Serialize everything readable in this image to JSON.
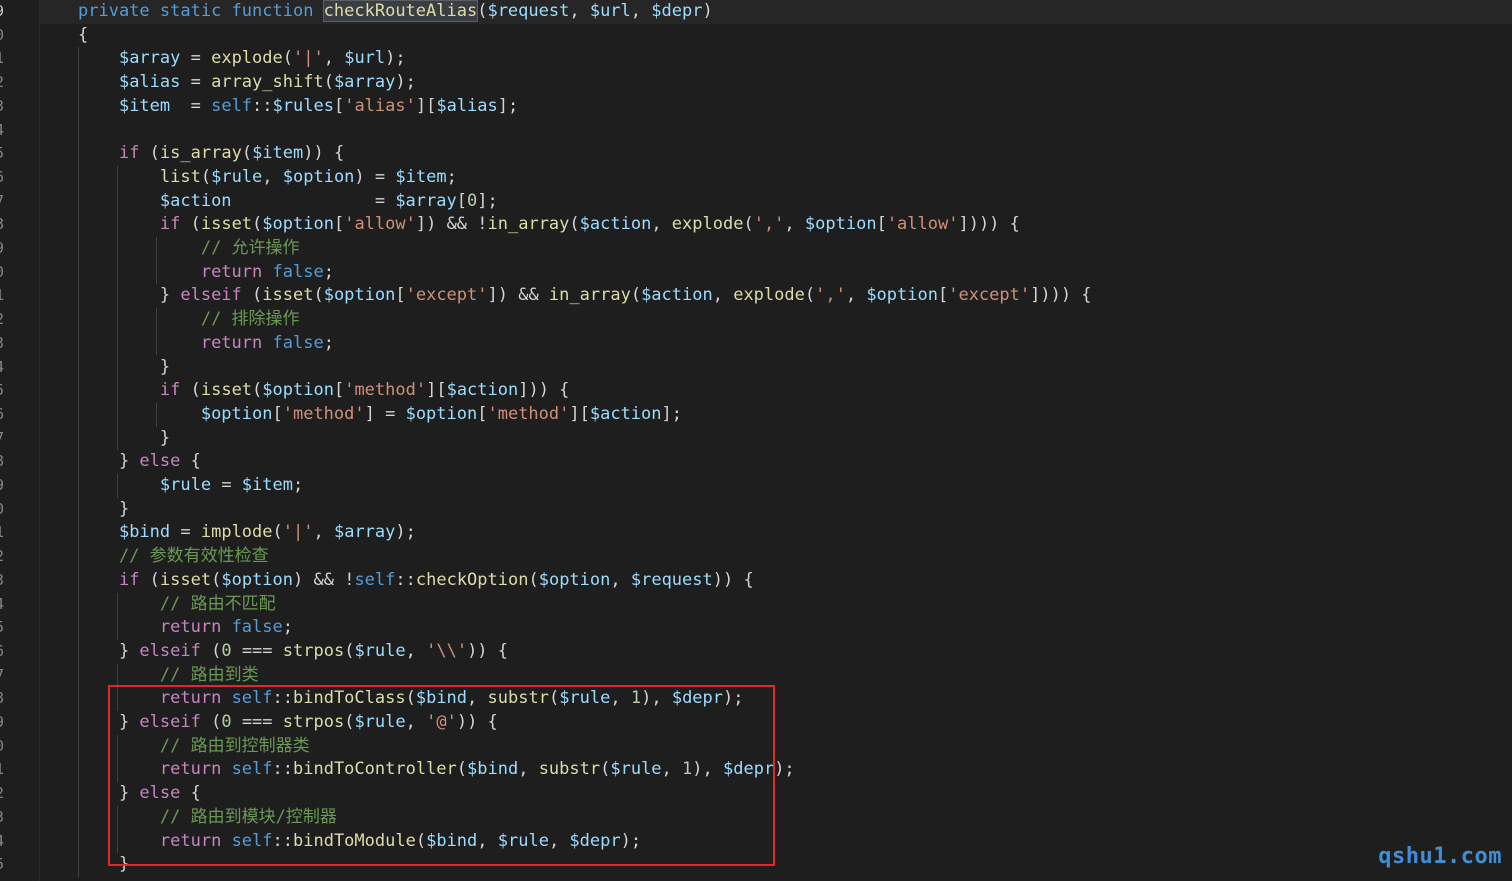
{
  "editor": {
    "line_numbers": [
      "9",
      "0",
      "1",
      "2",
      "3",
      "4",
      "5",
      "6",
      "7",
      "8",
      "9",
      "0",
      "1",
      "2",
      "3",
      "4",
      "5",
      "6",
      "7",
      "8",
      "9",
      "0",
      "1",
      "2",
      "3",
      "4",
      "5",
      "6",
      "7",
      "8",
      "9",
      "0",
      "1",
      "2",
      "3",
      "4",
      "5"
    ],
    "lines": [
      [
        [
          "kw",
          "private "
        ],
        [
          "kw",
          "static "
        ],
        [
          "kw",
          "function "
        ],
        [
          "fnhl",
          "checkRouteAlias"
        ],
        [
          "op",
          "("
        ],
        [
          "var",
          "$request"
        ],
        [
          "op",
          ", "
        ],
        [
          "var",
          "$url"
        ],
        [
          "op",
          ", "
        ],
        [
          "var",
          "$depr"
        ],
        [
          "op",
          ")"
        ]
      ],
      [
        [
          "op",
          "{"
        ]
      ],
      [
        [
          "op",
          "    "
        ],
        [
          "var",
          "$array"
        ],
        [
          "op",
          " = "
        ],
        [
          "fn",
          "explode"
        ],
        [
          "op",
          "("
        ],
        [
          "str",
          "'|'"
        ],
        [
          "op",
          ", "
        ],
        [
          "var",
          "$url"
        ],
        [
          "op",
          ");"
        ]
      ],
      [
        [
          "op",
          "    "
        ],
        [
          "var",
          "$alias"
        ],
        [
          "op",
          " = "
        ],
        [
          "fn",
          "array_shift"
        ],
        [
          "op",
          "("
        ],
        [
          "var",
          "$array"
        ],
        [
          "op",
          ");"
        ]
      ],
      [
        [
          "op",
          "    "
        ],
        [
          "var",
          "$item"
        ],
        [
          "op",
          "  = "
        ],
        [
          "kw",
          "self"
        ],
        [
          "op",
          "::"
        ],
        [
          "var",
          "$rules"
        ],
        [
          "op",
          "["
        ],
        [
          "str",
          "'alias'"
        ],
        [
          "op",
          "]["
        ],
        [
          "var",
          "$alias"
        ],
        [
          "op",
          "];"
        ]
      ],
      [],
      [
        [
          "op",
          "    "
        ],
        [
          "kw2",
          "if"
        ],
        [
          "op",
          " ("
        ],
        [
          "fn",
          "is_array"
        ],
        [
          "op",
          "("
        ],
        [
          "var",
          "$item"
        ],
        [
          "op",
          ")) {"
        ]
      ],
      [
        [
          "op",
          "        "
        ],
        [
          "fn",
          "list"
        ],
        [
          "op",
          "("
        ],
        [
          "var",
          "$rule"
        ],
        [
          "op",
          ", "
        ],
        [
          "var",
          "$option"
        ],
        [
          "op",
          ") = "
        ],
        [
          "var",
          "$item"
        ],
        [
          "op",
          ";"
        ]
      ],
      [
        [
          "op",
          "        "
        ],
        [
          "var",
          "$action"
        ],
        [
          "op",
          "              = "
        ],
        [
          "var",
          "$array"
        ],
        [
          "op",
          "["
        ],
        [
          "num",
          "0"
        ],
        [
          "op",
          "];"
        ]
      ],
      [
        [
          "op",
          "        "
        ],
        [
          "kw2",
          "if"
        ],
        [
          "op",
          " ("
        ],
        [
          "fn",
          "isset"
        ],
        [
          "op",
          "("
        ],
        [
          "var",
          "$option"
        ],
        [
          "op",
          "["
        ],
        [
          "str",
          "'allow'"
        ],
        [
          "op",
          "]) && !"
        ],
        [
          "fn",
          "in_array"
        ],
        [
          "op",
          "("
        ],
        [
          "var",
          "$action"
        ],
        [
          "op",
          ", "
        ],
        [
          "fn",
          "explode"
        ],
        [
          "op",
          "("
        ],
        [
          "str",
          "','"
        ],
        [
          "op",
          ", "
        ],
        [
          "var",
          "$option"
        ],
        [
          "op",
          "["
        ],
        [
          "str",
          "'allow'"
        ],
        [
          "op",
          "]))) {"
        ]
      ],
      [
        [
          "op",
          "            "
        ],
        [
          "cmt",
          "// 允许操作"
        ]
      ],
      [
        [
          "op",
          "            "
        ],
        [
          "kw2",
          "return"
        ],
        [
          "op",
          " "
        ],
        [
          "kw",
          "false"
        ],
        [
          "op",
          ";"
        ]
      ],
      [
        [
          "op",
          "        } "
        ],
        [
          "kw2",
          "elseif"
        ],
        [
          "op",
          " ("
        ],
        [
          "fn",
          "isset"
        ],
        [
          "op",
          "("
        ],
        [
          "var",
          "$option"
        ],
        [
          "op",
          "["
        ],
        [
          "str",
          "'except'"
        ],
        [
          "op",
          "]) && "
        ],
        [
          "fn",
          "in_array"
        ],
        [
          "op",
          "("
        ],
        [
          "var",
          "$action"
        ],
        [
          "op",
          ", "
        ],
        [
          "fn",
          "explode"
        ],
        [
          "op",
          "("
        ],
        [
          "str",
          "','"
        ],
        [
          "op",
          ", "
        ],
        [
          "var",
          "$option"
        ],
        [
          "op",
          "["
        ],
        [
          "str",
          "'except'"
        ],
        [
          "op",
          "]))) {"
        ]
      ],
      [
        [
          "op",
          "            "
        ],
        [
          "cmt",
          "// 排除操作"
        ]
      ],
      [
        [
          "op",
          "            "
        ],
        [
          "kw2",
          "return"
        ],
        [
          "op",
          " "
        ],
        [
          "kw",
          "false"
        ],
        [
          "op",
          ";"
        ]
      ],
      [
        [
          "op",
          "        }"
        ]
      ],
      [
        [
          "op",
          "        "
        ],
        [
          "kw2",
          "if"
        ],
        [
          "op",
          " ("
        ],
        [
          "fn",
          "isset"
        ],
        [
          "op",
          "("
        ],
        [
          "var",
          "$option"
        ],
        [
          "op",
          "["
        ],
        [
          "str",
          "'method'"
        ],
        [
          "op",
          "]["
        ],
        [
          "var",
          "$action"
        ],
        [
          "op",
          "])) {"
        ]
      ],
      [
        [
          "op",
          "            "
        ],
        [
          "var",
          "$option"
        ],
        [
          "op",
          "["
        ],
        [
          "str",
          "'method'"
        ],
        [
          "op",
          "] = "
        ],
        [
          "var",
          "$option"
        ],
        [
          "op",
          "["
        ],
        [
          "str",
          "'method'"
        ],
        [
          "op",
          "]["
        ],
        [
          "var",
          "$action"
        ],
        [
          "op",
          "];"
        ]
      ],
      [
        [
          "op",
          "        }"
        ]
      ],
      [
        [
          "op",
          "    } "
        ],
        [
          "kw2",
          "else"
        ],
        [
          "op",
          " {"
        ]
      ],
      [
        [
          "op",
          "        "
        ],
        [
          "var",
          "$rule"
        ],
        [
          "op",
          " = "
        ],
        [
          "var",
          "$item"
        ],
        [
          "op",
          ";"
        ]
      ],
      [
        [
          "op",
          "    }"
        ]
      ],
      [
        [
          "op",
          "    "
        ],
        [
          "var",
          "$bind"
        ],
        [
          "op",
          " = "
        ],
        [
          "fn",
          "implode"
        ],
        [
          "op",
          "("
        ],
        [
          "str",
          "'|'"
        ],
        [
          "op",
          ", "
        ],
        [
          "var",
          "$array"
        ],
        [
          "op",
          ");"
        ]
      ],
      [
        [
          "op",
          "    "
        ],
        [
          "cmt",
          "// 参数有效性检查"
        ]
      ],
      [
        [
          "op",
          "    "
        ],
        [
          "kw2",
          "if"
        ],
        [
          "op",
          " ("
        ],
        [
          "fn",
          "isset"
        ],
        [
          "op",
          "("
        ],
        [
          "var",
          "$option"
        ],
        [
          "op",
          ") && !"
        ],
        [
          "kw",
          "self"
        ],
        [
          "op",
          "::"
        ],
        [
          "fn",
          "checkOption"
        ],
        [
          "op",
          "("
        ],
        [
          "var",
          "$option"
        ],
        [
          "op",
          ", "
        ],
        [
          "var",
          "$request"
        ],
        [
          "op",
          ")) {"
        ]
      ],
      [
        [
          "op",
          "        "
        ],
        [
          "cmt",
          "// 路由不匹配"
        ]
      ],
      [
        [
          "op",
          "        "
        ],
        [
          "kw2",
          "return"
        ],
        [
          "op",
          " "
        ],
        [
          "kw",
          "false"
        ],
        [
          "op",
          ";"
        ]
      ],
      [
        [
          "op",
          "    } "
        ],
        [
          "kw2",
          "elseif"
        ],
        [
          "op",
          " ("
        ],
        [
          "num",
          "0"
        ],
        [
          "op",
          " === "
        ],
        [
          "fn",
          "strpos"
        ],
        [
          "op",
          "("
        ],
        [
          "var",
          "$rule"
        ],
        [
          "op",
          ", "
        ],
        [
          "str",
          "'\\\\'"
        ],
        [
          "op",
          ")) {"
        ]
      ],
      [
        [
          "op",
          "        "
        ],
        [
          "cmt",
          "// 路由到类"
        ]
      ],
      [
        [
          "op",
          "        "
        ],
        [
          "kw2",
          "return"
        ],
        [
          "op",
          " "
        ],
        [
          "kw",
          "self"
        ],
        [
          "op",
          "::"
        ],
        [
          "fn",
          "bindToClass"
        ],
        [
          "op",
          "("
        ],
        [
          "var",
          "$bind"
        ],
        [
          "op",
          ", "
        ],
        [
          "fn",
          "substr"
        ],
        [
          "op",
          "("
        ],
        [
          "var",
          "$rule"
        ],
        [
          "op",
          ", "
        ],
        [
          "num",
          "1"
        ],
        [
          "op",
          "), "
        ],
        [
          "var",
          "$depr"
        ],
        [
          "op",
          ");"
        ]
      ],
      [
        [
          "op",
          "    } "
        ],
        [
          "kw2",
          "elseif"
        ],
        [
          "op",
          " ("
        ],
        [
          "num",
          "0"
        ],
        [
          "op",
          " === "
        ],
        [
          "fn",
          "strpos"
        ],
        [
          "op",
          "("
        ],
        [
          "var",
          "$rule"
        ],
        [
          "op",
          ", "
        ],
        [
          "str",
          "'@'"
        ],
        [
          "op",
          ")) {"
        ]
      ],
      [
        [
          "op",
          "        "
        ],
        [
          "cmt",
          "// 路由到控制器类"
        ]
      ],
      [
        [
          "op",
          "        "
        ],
        [
          "kw2",
          "return"
        ],
        [
          "op",
          " "
        ],
        [
          "kw",
          "self"
        ],
        [
          "op",
          "::"
        ],
        [
          "fn",
          "bindToController"
        ],
        [
          "op",
          "("
        ],
        [
          "var",
          "$bind"
        ],
        [
          "op",
          ", "
        ],
        [
          "fn",
          "substr"
        ],
        [
          "op",
          "("
        ],
        [
          "var",
          "$rule"
        ],
        [
          "op",
          ", "
        ],
        [
          "num",
          "1"
        ],
        [
          "op",
          "), "
        ],
        [
          "var",
          "$depr"
        ],
        [
          "op",
          ");"
        ]
      ],
      [
        [
          "op",
          "    } "
        ],
        [
          "kw2",
          "else"
        ],
        [
          "op",
          " {"
        ]
      ],
      [
        [
          "op",
          "        "
        ],
        [
          "cmt",
          "// 路由到模块/控制器"
        ]
      ],
      [
        [
          "op",
          "        "
        ],
        [
          "kw2",
          "return"
        ],
        [
          "op",
          " "
        ],
        [
          "kw",
          "self"
        ],
        [
          "op",
          "::"
        ],
        [
          "fn",
          "bindToModule"
        ],
        [
          "op",
          "("
        ],
        [
          "var",
          "$bind"
        ],
        [
          "op",
          ", "
        ],
        [
          "var",
          "$rule"
        ],
        [
          "op",
          ", "
        ],
        [
          "var",
          "$depr"
        ],
        [
          "op",
          ");"
        ]
      ],
      [
        [
          "op",
          "    }"
        ]
      ]
    ]
  },
  "watermark": "qshu1.com",
  "colors": {
    "background": "#1e1e1e",
    "highlight_box": "#e0272b",
    "watermark": "#3f8fd8"
  }
}
